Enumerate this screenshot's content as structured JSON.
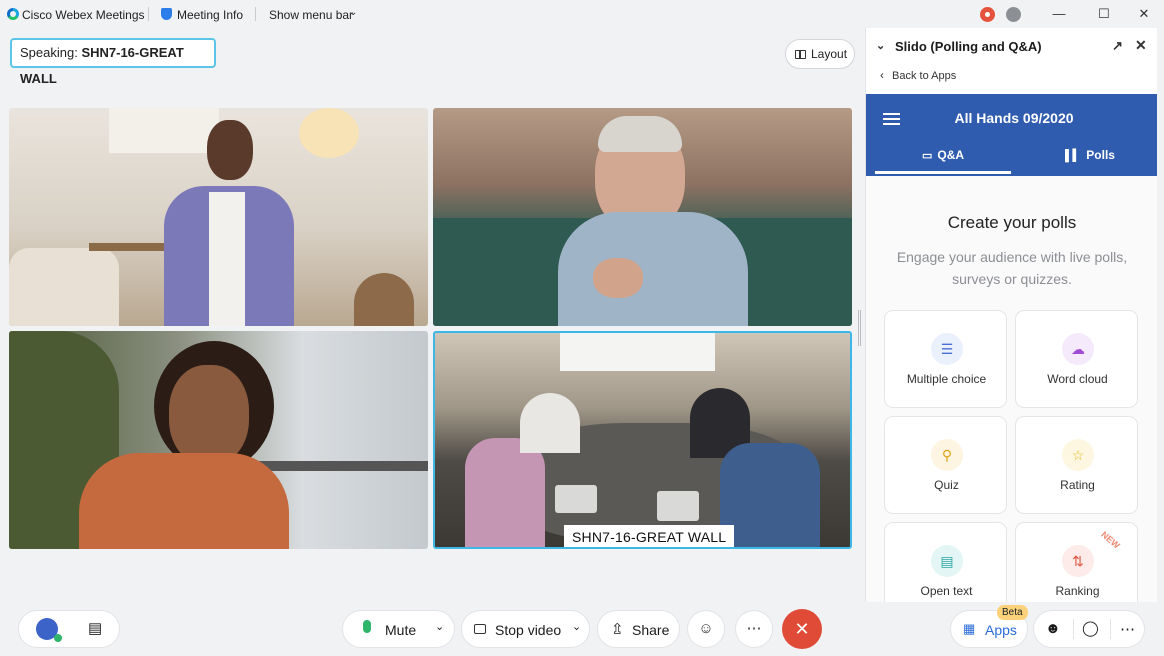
{
  "titlebar": {
    "app_name": "Cisco Webex Meetings",
    "meeting_info": "Meeting Info",
    "show_menu": "Show menu bar"
  },
  "speaking": {
    "prefix": "Speaking: ",
    "name": "SHN7-16-GREAT WALL"
  },
  "layout_label": "Layout",
  "video_tiles": [
    {
      "name_tag": ""
    },
    {
      "name_tag": ""
    },
    {
      "name_tag": ""
    },
    {
      "name_tag": "SHN7-16-GREAT WALL"
    }
  ],
  "panel": {
    "title": "Slido (Polling and Q&A)",
    "back_label": "Back to Apps",
    "event_title": "All Hands 09/2020",
    "tabs": [
      {
        "label": "Q&A"
      },
      {
        "label": "Polls"
      }
    ],
    "create_title": "Create your polls",
    "create_subtitle": "Engage your audience with live polls, surveys or quizzes.",
    "cards": [
      {
        "label": "Multiple choice",
        "icon": "list-icon",
        "color": "#4a6fd6",
        "bg": "#eaf0fc"
      },
      {
        "label": "Word cloud",
        "icon": "cloud-icon",
        "color": "#a24bd4",
        "bg": "#f4eafb"
      },
      {
        "label": "Quiz",
        "icon": "trophy-icon",
        "color": "#e2a21b",
        "bg": "#fdf4e2"
      },
      {
        "label": "Rating",
        "icon": "star-icon",
        "color": "#e2b81b",
        "bg": "#fdf7e2"
      },
      {
        "label": "Open text",
        "icon": "speech-bubble-icon",
        "color": "#2aa5a0",
        "bg": "#e3f5f4"
      },
      {
        "label": "Ranking",
        "icon": "ranking-arrows-icon",
        "color": "#e05a46",
        "bg": "#fcebe8"
      }
    ],
    "new_badge": "NEW"
  },
  "controls": {
    "mute": "Mute",
    "stop_video": "Stop video",
    "share": "Share",
    "apps": "Apps",
    "beta": "Beta"
  },
  "colors": {
    "accent": "#2f5cae",
    "end_call": "#e04b37",
    "active_border": "#3cb7e6"
  }
}
